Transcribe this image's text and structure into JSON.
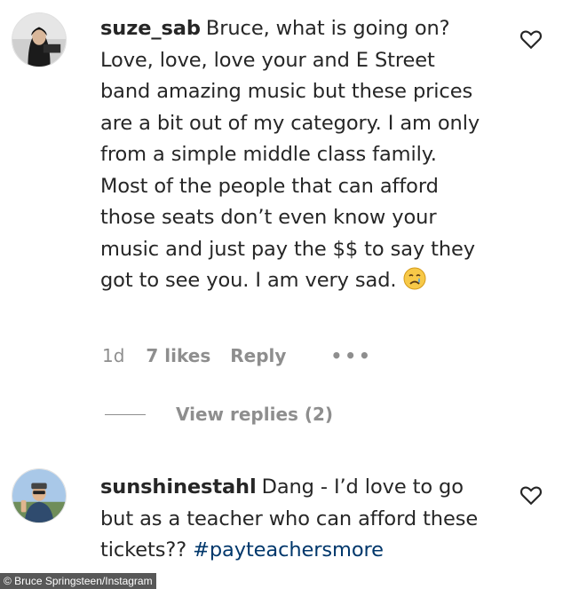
{
  "comments": [
    {
      "username": "suze_sab",
      "text": "Bruce, what is going on? Love, love, love your and E Street band amazing music but these prices are a bit out of my category. I am only from a simple middle class family. Most of the people that can afford those seats don’t even know your music and just pay the $$ to say they got to see you. I am very sad.",
      "emoji": "crying-face",
      "time": "1d",
      "likes": "7 likes",
      "reply_label": "Reply",
      "more_label": "•••",
      "view_replies": "View replies (2)"
    },
    {
      "username": "sunshinestahl",
      "text": "Dang - I’d love to go but as a teacher who can afford these tickets??",
      "hashtag": "#payteachersmore"
    }
  ],
  "credit": "© Bruce Springsteen/Instagram",
  "colors": {
    "text": "#262626",
    "meta": "#8e8e8e",
    "hashtag": "#00376b"
  }
}
